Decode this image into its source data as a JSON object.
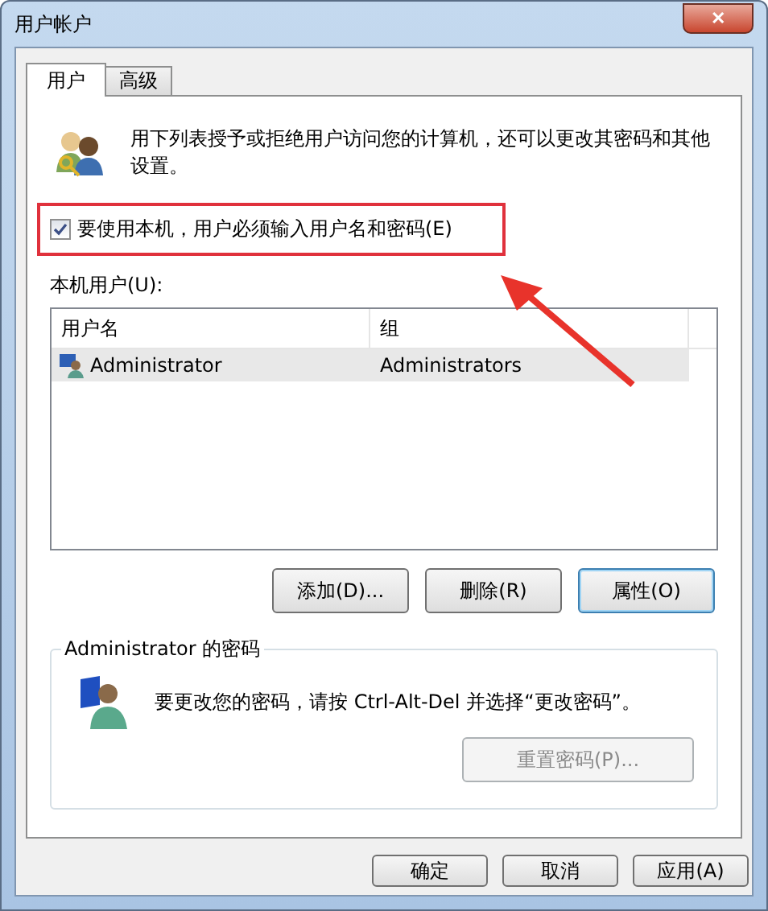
{
  "window": {
    "title": "用户帐户",
    "close": "✕"
  },
  "tabs": [
    {
      "label": "用户",
      "selected": true
    },
    {
      "label": "高级",
      "selected": false
    }
  ],
  "intro": "用下列表授予或拒绝用户访问您的计算机，还可以更改其密码和其他设置。",
  "require_login": {
    "label": "要使用本机，用户必须输入用户名和密码(E)",
    "checked": true
  },
  "users_label": "本机用户(U):",
  "table": {
    "columns": [
      "用户名",
      "组"
    ],
    "rows": [
      {
        "cells": [
          "Administrator",
          "Administrators"
        ],
        "selected": true
      }
    ]
  },
  "user_buttons": [
    {
      "label": "添加(D)...",
      "default": false
    },
    {
      "label": "删除(R)",
      "default": false
    },
    {
      "label": "属性(O)",
      "default": true
    }
  ],
  "password_group": {
    "title": "Administrator 的密码",
    "text": "要更改您的密码，请按 Ctrl-Alt-Del 并选择“更改密码”。",
    "reset_button": {
      "label": "重置密码(P)...",
      "disabled": true
    }
  },
  "dialog_buttons": [
    "确定",
    "取消",
    "应用(A)"
  ]
}
